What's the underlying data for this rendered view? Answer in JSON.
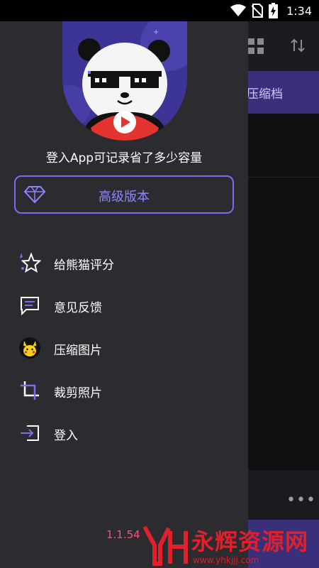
{
  "status_bar": {
    "time": "1:34",
    "icons": [
      "wifi-icon",
      "no-sim-icon",
      "battery-charging-icon"
    ]
  },
  "background_app": {
    "toolbar_icons": [
      "grid-view-icon",
      "sort-icon"
    ],
    "banner_text": "压缩档",
    "more_label": "•••"
  },
  "drawer": {
    "login_hint": "登入App可记录省了多少容量",
    "premium_label": "高级版本",
    "menu": [
      {
        "label": "给熊猫评分",
        "icon": "star-rate-icon"
      },
      {
        "label": "意见反馈",
        "icon": "feedback-icon"
      },
      {
        "label": "压缩图片",
        "icon": "pikachu-icon"
      },
      {
        "label": "裁剪照片",
        "icon": "crop-icon"
      },
      {
        "label": "登入",
        "icon": "login-icon"
      }
    ],
    "version": "1.1.54"
  },
  "watermark": {
    "text": "永辉资源网",
    "url": "www.yhkjjj.com"
  },
  "colors": {
    "accent": "#7a6ef0",
    "drawer_bg": "#2b2b30",
    "version": "#ff4f7b",
    "watermark": "#e0202a"
  }
}
